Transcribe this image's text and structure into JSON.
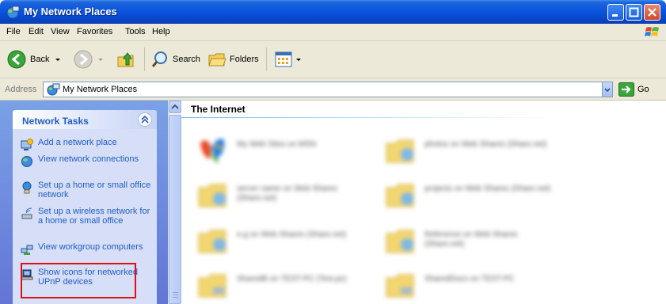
{
  "window": {
    "title": "My Network Places"
  },
  "menu": [
    "File",
    "Edit",
    "View",
    "Favorites",
    "Tools",
    "Help"
  ],
  "toolbar": {
    "back_label": "Back",
    "search_label": "Search",
    "folders_label": "Folders"
  },
  "address": {
    "label": "Address",
    "value": "My Network Places",
    "go_label": "Go"
  },
  "task_pane": {
    "header": "Network Tasks",
    "tasks": [
      {
        "label": "Add a network place",
        "icon": "add-network-place-icon"
      },
      {
        "label": "View network connections",
        "icon": "network-connections-icon"
      },
      {
        "label": "Set up a home or small office network",
        "icon": "home-network-icon"
      },
      {
        "label": "Set up a wireless network for a home or small office",
        "icon": "wireless-network-icon"
      },
      {
        "label": "View workgroup computers",
        "icon": "workgroup-icon"
      },
      {
        "label": "Show icons for networked UPnP devices",
        "icon": "upnp-devices-icon"
      }
    ]
  },
  "content": {
    "group_title": "The Internet",
    "items": [
      {
        "label": "My Web Sites on MSN"
      },
      {
        "label": "photos on Web Shares (Share.net)"
      },
      {
        "label": "server name on Web Shares (Share.net)"
      },
      {
        "label": "projects on Web Shares (Share.net)"
      },
      {
        "label": "e.g on Web Shares (Share.net)"
      },
      {
        "label": "Reference on Web Shares (Share.net)"
      },
      {
        "label": "SharedB on TEST-PC (Test.pc)"
      },
      {
        "label": "SharedDocs on TEST-PC"
      }
    ]
  },
  "colors": {
    "title_bar": "#0a55e0",
    "task_link": "#215dc6",
    "highlight": "#e01010"
  }
}
